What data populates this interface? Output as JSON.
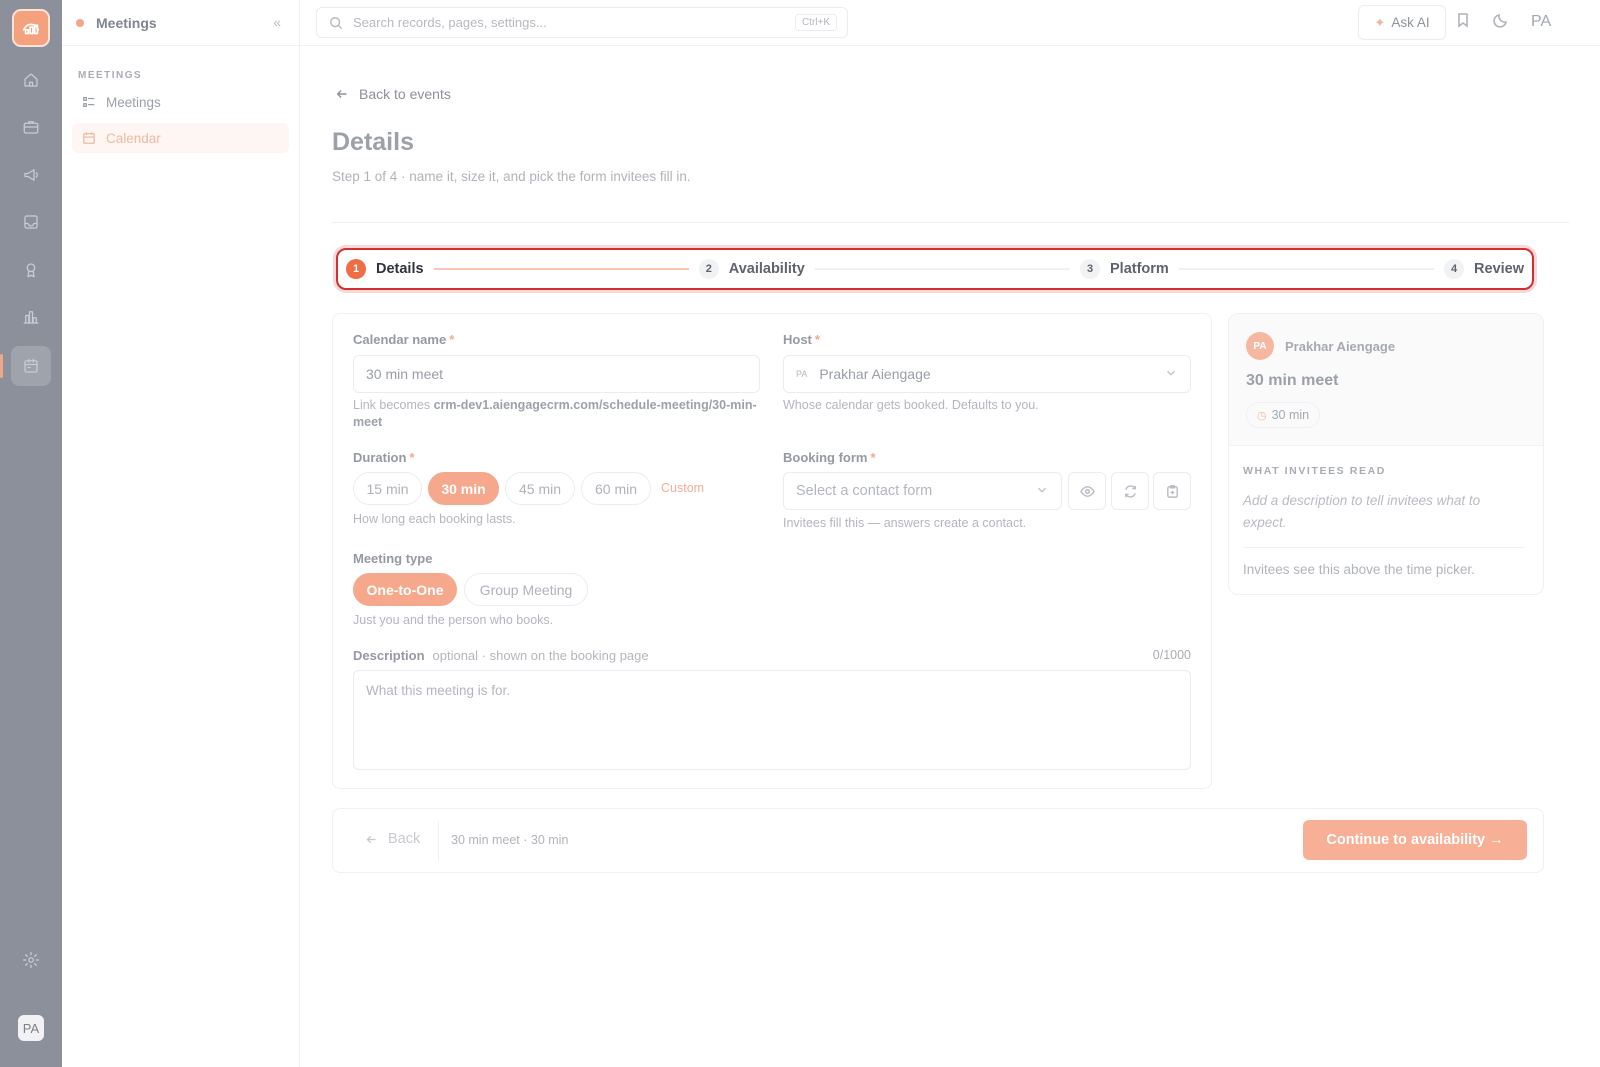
{
  "sidebar": {
    "title": "Meetings",
    "section": "MEETINGS",
    "items": [
      {
        "label": "Meetings",
        "active": false
      },
      {
        "label": "Calendar",
        "active": true
      }
    ],
    "avatar": "PA"
  },
  "topbar": {
    "search_placeholder": "Search records, pages, settings...",
    "shortcut": "Ctrl+K",
    "ask_ai": "Ask AI",
    "user": "PA"
  },
  "page": {
    "back": "Back to events",
    "title": "Details",
    "subtitle": "Step 1 of 4 · name it, size it, and pick the form invitees fill in."
  },
  "steps": [
    {
      "num": "1",
      "label": "Details"
    },
    {
      "num": "2",
      "label": "Availability"
    },
    {
      "num": "3",
      "label": "Platform"
    },
    {
      "num": "4",
      "label": "Review"
    }
  ],
  "form": {
    "calendar_name_label": "Calendar name",
    "required_mark": "*",
    "calendar_name_value": "30 min meet",
    "link_prefix": "Link becomes ",
    "link_url": "crm-dev1.aiengagecrm.com/schedule-meeting/30-min-meet",
    "host_label": "Host",
    "host_initials": "PA",
    "host_value": "Prakhar Aiengage",
    "host_help": "Whose calendar gets booked. Defaults to you.",
    "duration_label": "Duration",
    "durations": [
      "15 min",
      "30 min",
      "45 min",
      "60 min"
    ],
    "custom": "Custom",
    "duration_help": "How long each booking lasts.",
    "booking_form_label": "Booking form",
    "booking_form_placeholder": "Select a contact form",
    "booking_form_help": "Invitees fill this — answers create a contact.",
    "meeting_type_label": "Meeting type",
    "meeting_types": [
      "One-to-One",
      "Group Meeting"
    ],
    "meeting_type_help": "Just you and the person who books.",
    "description_label": "Description",
    "description_hint": "optional · shown on the booking page",
    "description_count": "0/1000",
    "description_placeholder": "What this meeting is for."
  },
  "preview": {
    "initials": "PA",
    "host": "Prakhar Aiengage",
    "title": "30 min meet",
    "duration": "30 min",
    "section": "WHAT INVITEES READ",
    "placeholder": "Add a description to tell invitees what to expect.",
    "note": "Invitees see this above the time picker."
  },
  "footer": {
    "back": "Back",
    "summary": "30 min meet · 30 min",
    "continue": "Continue to availability →"
  },
  "colors": {
    "accent": "#ef6c47",
    "highlight": "#d32f2f"
  }
}
